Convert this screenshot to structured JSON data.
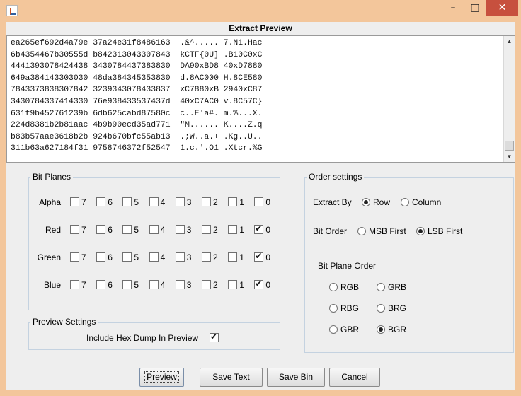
{
  "window": {
    "title": ""
  },
  "preview": {
    "title": "Extract Preview",
    "hex_lines": [
      "ea265ef692d4a79e 37a24e31f8486163  .&^..... 7.N1.Hac",
      "6b4354467b30555d b842313043307843  kCTF{0U] .B10C0xC",
      "4441393078424438 3430784437383830  DA90xBD8 40xD7880",
      "649a384143303030 48da384345353830  d.8AC000 H.8CE580",
      "7843373838307842 3239343078433837  xC7880xB 2940xC87",
      "3430784337414330 76e938433537437d  40xC7AC0 v.8C57C}",
      "631f9b452761239b 6db625cabd87580c  c..E'a#. m.%...X.",
      "224d8381b2b81aac 4b9b90ecd35ad771  \"M...... K....Z.q",
      "b83b57aae3618b2b 924b670bfc55ab13  .;W..a.+ .Kg..U..",
      "311b63a627184f31 9758746372f52547  1.c.'.O1 .Xtcr.%G"
    ]
  },
  "bit_planes": {
    "title": "Bit Planes",
    "bits": [
      "7",
      "6",
      "5",
      "4",
      "3",
      "2",
      "1",
      "0"
    ],
    "rows": [
      {
        "label": "Alpha",
        "checked": [
          false,
          false,
          false,
          false,
          false,
          false,
          false,
          false
        ]
      },
      {
        "label": "Red",
        "checked": [
          false,
          false,
          false,
          false,
          false,
          false,
          false,
          true
        ]
      },
      {
        "label": "Green",
        "checked": [
          false,
          false,
          false,
          false,
          false,
          false,
          false,
          true
        ]
      },
      {
        "label": "Blue",
        "checked": [
          false,
          false,
          false,
          false,
          false,
          false,
          false,
          true
        ]
      }
    ]
  },
  "preview_settings": {
    "title": "Preview Settings",
    "hex_dump_label": "Include Hex Dump In Preview",
    "hex_dump_checked": true
  },
  "order_settings": {
    "title": "Order settings",
    "extract_by_label": "Extract By",
    "extract_by_options": [
      "Row",
      "Column"
    ],
    "extract_by_selected": "Row",
    "bit_order_label": "Bit Order",
    "bit_order_options": [
      "MSB First",
      "LSB First"
    ],
    "bit_order_selected": "LSB First",
    "plane_order_label": "Bit Plane Order",
    "plane_order_options": [
      "RGB",
      "GRB",
      "RBG",
      "BRG",
      "GBR",
      "BGR"
    ],
    "plane_order_selected": "BGR"
  },
  "buttons": {
    "preview": "Preview",
    "save_text": "Save Text",
    "save_bin": "Save Bin",
    "cancel": "Cancel"
  },
  "window_controls": {
    "minimize": "–",
    "maximize": "□",
    "close": "✕"
  }
}
